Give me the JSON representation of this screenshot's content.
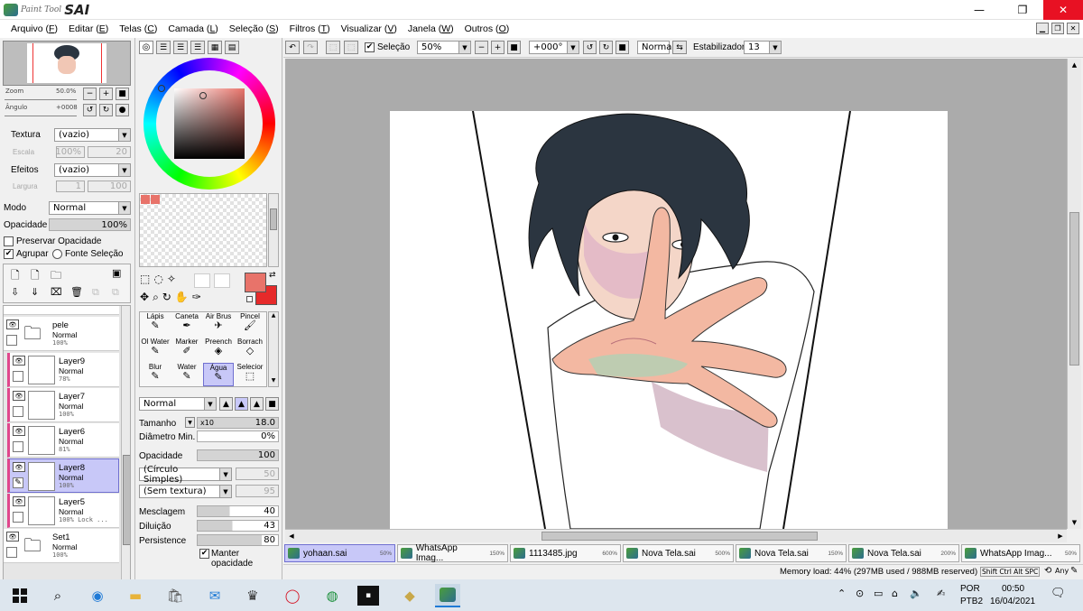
{
  "app": {
    "logo_small": "Paint Tool",
    "logo_big": "SAI"
  },
  "window": {
    "minimize": "—",
    "restore": "❐",
    "close": "✕"
  },
  "menu": [
    {
      "pre": "Arquivo (",
      "key": "F",
      "post": ")"
    },
    {
      "pre": "Editar (",
      "key": "E",
      "post": ")"
    },
    {
      "pre": "Telas (",
      "key": "C",
      "post": ")"
    },
    {
      "pre": "Camada (",
      "key": "L",
      "post": ")"
    },
    {
      "pre": "Seleção (",
      "key": "S",
      "post": ")"
    },
    {
      "pre": "Filtros (",
      "key": "T",
      "post": ")"
    },
    {
      "pre": "Visualizar (",
      "key": "V",
      "post": ")"
    },
    {
      "pre": "Janela (",
      "key": "W",
      "post": ")"
    },
    {
      "pre": "Outros (",
      "key": "O",
      "post": ")"
    }
  ],
  "navigator": {
    "zoom_label": "Zoom",
    "zoom_value": "50.0%",
    "angle_label": "Ângulo",
    "angle_value": "+0008"
  },
  "texture": {
    "label": "Textura",
    "value": "(vazio)",
    "scale_label": "Escala",
    "scale_value": "100%",
    "amount": "20"
  },
  "effects": {
    "label": "Efeitos",
    "value": "(vazio)",
    "width_label": "Largura",
    "width_value": "1",
    "amount": "100"
  },
  "mode": {
    "label": "Modo",
    "value": "Normal"
  },
  "opacity": {
    "label": "Opacidade",
    "value": "100%",
    "fill": 1.0
  },
  "preserve_opacity": "Preservar Opacidade",
  "group": "Agrupar",
  "source_selection": "Fonte Seleção",
  "layers": [
    {
      "name": "pele",
      "mode": "Normal",
      "opacity": "100%",
      "folder": true
    },
    {
      "name": "Layer9",
      "mode": "Normal",
      "opacity": "78%"
    },
    {
      "name": "Layer7",
      "mode": "Normal",
      "opacity": "100%"
    },
    {
      "name": "Layer6",
      "mode": "Normal",
      "opacity": "81%"
    },
    {
      "name": "Layer8",
      "mode": "Normal",
      "opacity": "100%",
      "selected": true
    },
    {
      "name": "Layer5",
      "mode": "Normal",
      "opacity": "100% Lock ..."
    },
    {
      "name": "Set1",
      "mode": "Normal",
      "opacity": "100%",
      "folder": true
    }
  ],
  "tools": [
    {
      "label": "Lápis",
      "icon": "✎"
    },
    {
      "label": "Caneta",
      "icon": "✒"
    },
    {
      "label": "Air Brus",
      "icon": "✈"
    },
    {
      "label": "Pincel",
      "icon": "🖌"
    },
    {
      "label": "Ol Water",
      "icon": "✎"
    },
    {
      "label": "Marker",
      "icon": "✐"
    },
    {
      "label": "Preench",
      "icon": "◈"
    },
    {
      "label": "Borrach",
      "icon": "◇"
    },
    {
      "label": "Blur",
      "icon": "✎"
    },
    {
      "label": "Water",
      "icon": "✎"
    },
    {
      "label": "Água",
      "icon": "✎",
      "selected": true
    },
    {
      "label": "Selecior",
      "icon": "⬚"
    }
  ],
  "brush": {
    "blend_mode": "Normal",
    "size_label": "Tamanho",
    "size_mult": "x10",
    "size_value": "18.0",
    "min_diam_label": "Diâmetro Min.",
    "min_diam_value": "0%",
    "density_label": "Opacidade",
    "density_value": "100",
    "shape": "(Círculo Simples)",
    "shape_value": "50",
    "texture": "(Sem textura)",
    "texture_value": "95",
    "blend_label": "Mesclagem",
    "blend_value": "40",
    "dilution_label": "Diluição",
    "dilution_value": "43",
    "persistence_label": "Persistence",
    "persistence_value": "80",
    "keep_opacity": "Manter opacidade"
  },
  "toolbar": {
    "selection": "Seleção",
    "zoom": "50%",
    "angle": "+000°",
    "blend": "Normal",
    "stabilizer_label": "Estabilizador",
    "stabilizer_value": "13"
  },
  "doc_tabs": [
    {
      "name": "yohaan.sai",
      "pct": "50%",
      "active": true
    },
    {
      "name": "WhatsApp Imag...",
      "pct": "150%"
    },
    {
      "name": "1113485.jpg",
      "pct": "600%"
    },
    {
      "name": "Nova Tela.sai",
      "pct": "500%"
    },
    {
      "name": "Nova Tela.sai",
      "pct": "150%"
    },
    {
      "name": "Nova Tela.sai",
      "pct": "200%"
    },
    {
      "name": "WhatsApp Imag...",
      "pct": "50%"
    }
  ],
  "status": {
    "memory": "Memory load: 44% (297MB used / 988MB reserved)",
    "keys": "Shift Ctrl Alt SPC",
    "any": "Any"
  },
  "taskbar": {
    "lang1": "POR",
    "lang2": "PTB2",
    "time": "00:50",
    "date": "16/04/2021"
  },
  "colors": {
    "primary": "#e8736a",
    "secondary": "#e62a2a",
    "hair": "#2b3540",
    "selection": "#c8c8f8"
  }
}
